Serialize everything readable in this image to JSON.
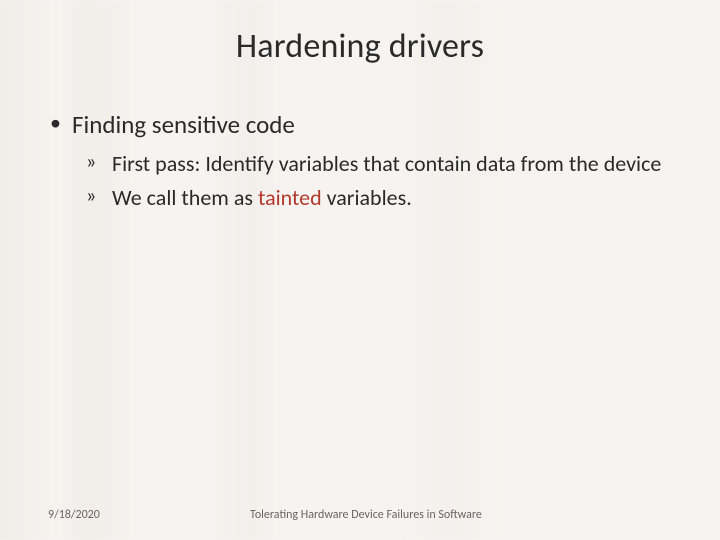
{
  "title": "Hardening drivers",
  "bullets": {
    "l1": {
      "text": "Finding sensitive code",
      "children": [
        {
          "text": "First pass: Identify variables that contain data from the device"
        },
        {
          "prefix": "We call them as ",
          "em": "tainted",
          "suffix": " variables."
        }
      ]
    }
  },
  "footer": {
    "date": "9/18/2020",
    "caption": "Tolerating Hardware Device Failures in Software"
  }
}
